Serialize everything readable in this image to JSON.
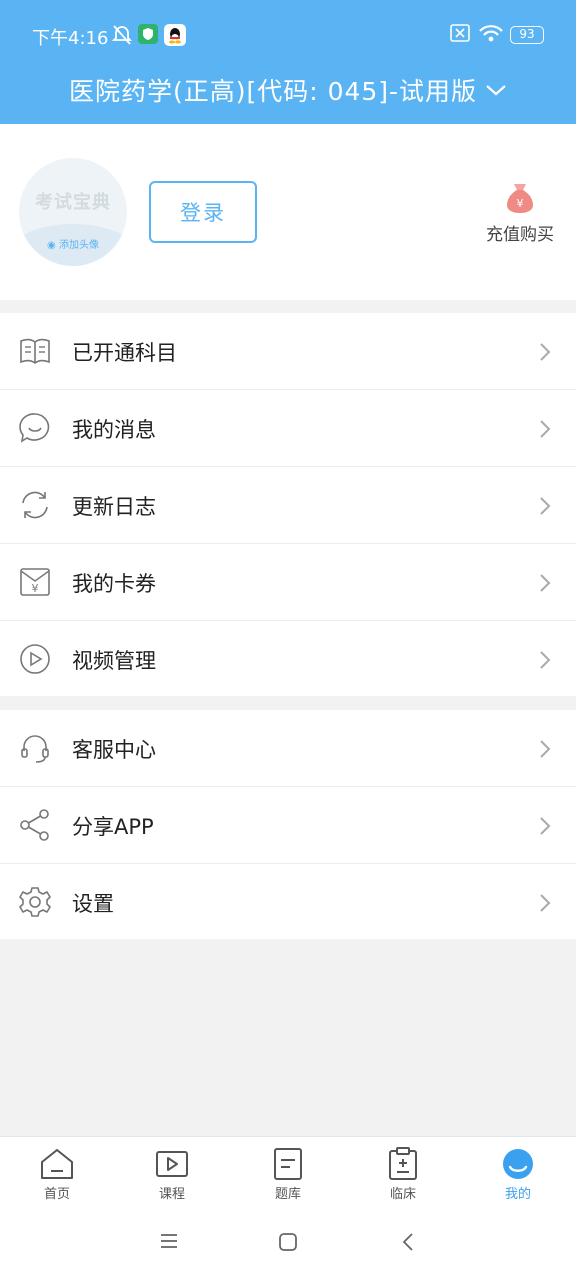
{
  "status_bar": {
    "time": "下午4:16",
    "battery": "93",
    "icons": [
      "alarm-off-icon",
      "shield-app-icon",
      "qq-icon",
      "sim-x-icon",
      "wifi-icon",
      "battery-icon"
    ]
  },
  "header": {
    "title": "医院药学(正高)[代码: 045]-试用版",
    "accent_color": "#5ab4f4"
  },
  "profile": {
    "avatar_logo": "考试宝典",
    "avatar_add": "添加头像",
    "login_label": "登录",
    "recharge_label": "充值购买"
  },
  "menu_group_1": [
    {
      "label": "已开通科目",
      "icon": "book-icon"
    },
    {
      "label": "我的消息",
      "icon": "message-icon"
    },
    {
      "label": "更新日志",
      "icon": "refresh-icon"
    },
    {
      "label": "我的卡券",
      "icon": "coupon-icon"
    },
    {
      "label": "视频管理",
      "icon": "video-play-icon"
    }
  ],
  "menu_group_2": [
    {
      "label": "客服中心",
      "icon": "headset-icon"
    },
    {
      "label": "分享APP",
      "icon": "share-icon"
    },
    {
      "label": "设置",
      "icon": "gear-icon"
    }
  ],
  "bottom_nav": [
    {
      "label": "首页",
      "icon": "home-icon",
      "active": false
    },
    {
      "label": "课程",
      "icon": "course-icon",
      "active": false
    },
    {
      "label": "题库",
      "icon": "question-bank-icon",
      "active": false
    },
    {
      "label": "临床",
      "icon": "clinic-icon",
      "active": false
    },
    {
      "label": "我的",
      "icon": "mine-icon",
      "active": true
    }
  ]
}
